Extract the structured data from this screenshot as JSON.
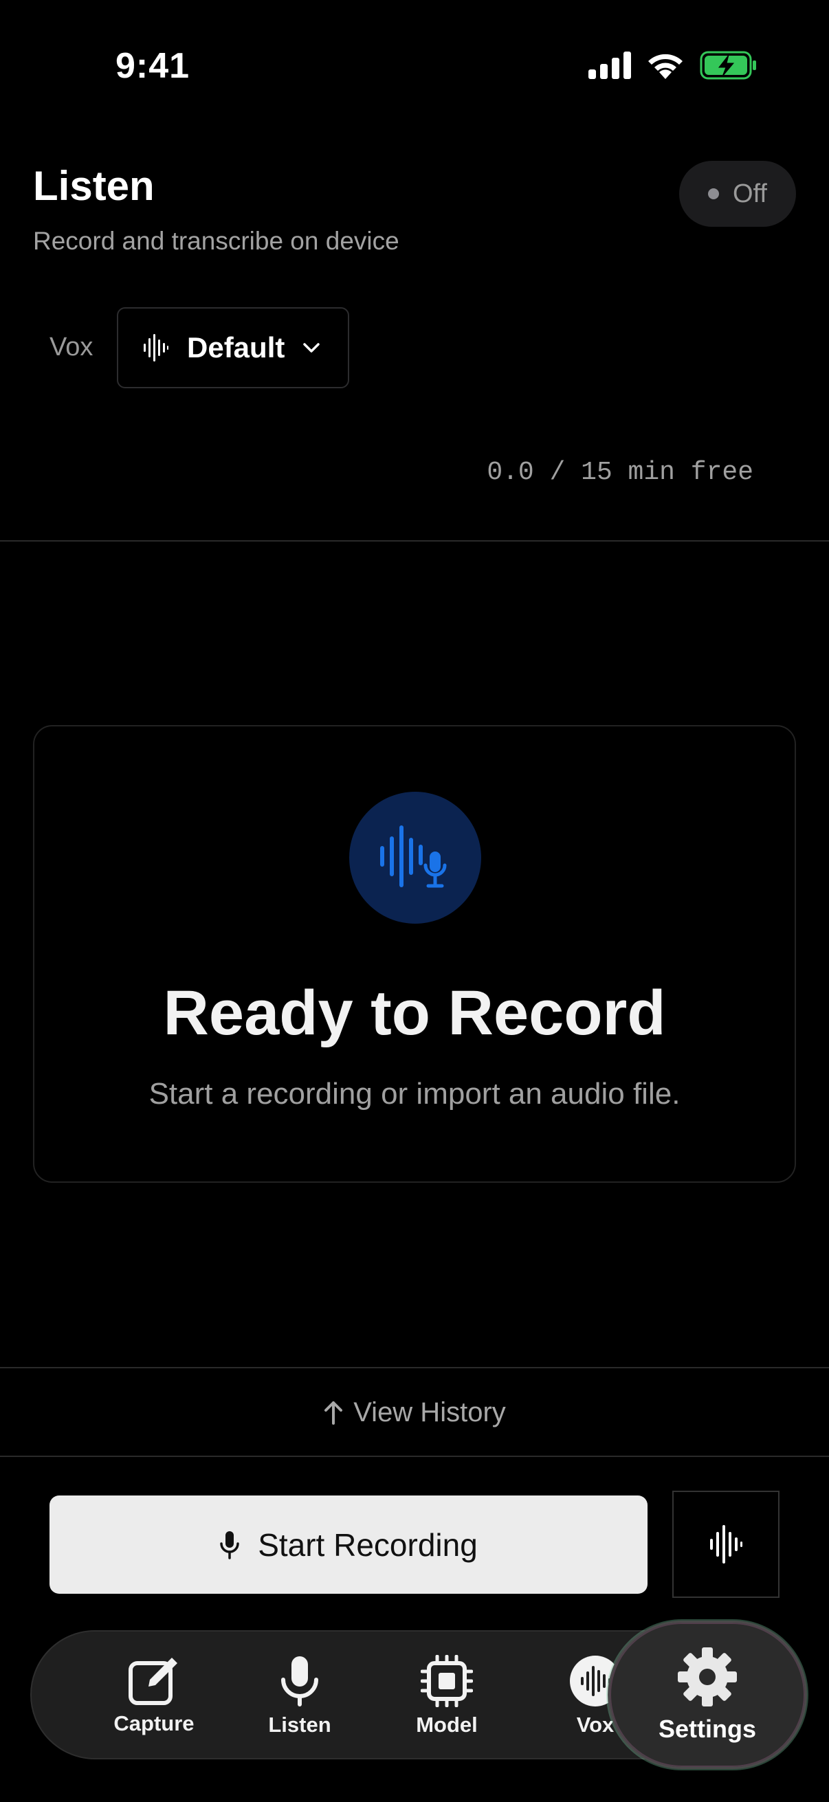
{
  "status_bar": {
    "time": "9:41",
    "icons": [
      "cellular-icon",
      "wifi-icon",
      "battery-charging-icon"
    ]
  },
  "header": {
    "title": "Listen",
    "subtitle": "Record and transcribe on device",
    "status_toggle": "Off"
  },
  "vox": {
    "label": "Vox",
    "selected": "Default"
  },
  "usage": {
    "text": "0.0 / 15 min free"
  },
  "empty_state": {
    "title": "Ready to Record",
    "subtitle": "Start a recording or import an audio file."
  },
  "history": {
    "label": "View History"
  },
  "actions": {
    "start_recording": "Start Recording"
  },
  "tabs": [
    {
      "label": "Capture",
      "icon": "edit-square-icon"
    },
    {
      "label": "Listen",
      "icon": "microphone-icon"
    },
    {
      "label": "Model",
      "icon": "chip-icon"
    },
    {
      "label": "Vox",
      "icon": "waveform-circle-icon"
    },
    {
      "label": "Settings",
      "icon": "gear-icon"
    }
  ],
  "colors": {
    "background": "#000000",
    "accent_blue": "#1a73e8",
    "icon_circle": "#0b2350",
    "battery_green": "#34c759"
  }
}
